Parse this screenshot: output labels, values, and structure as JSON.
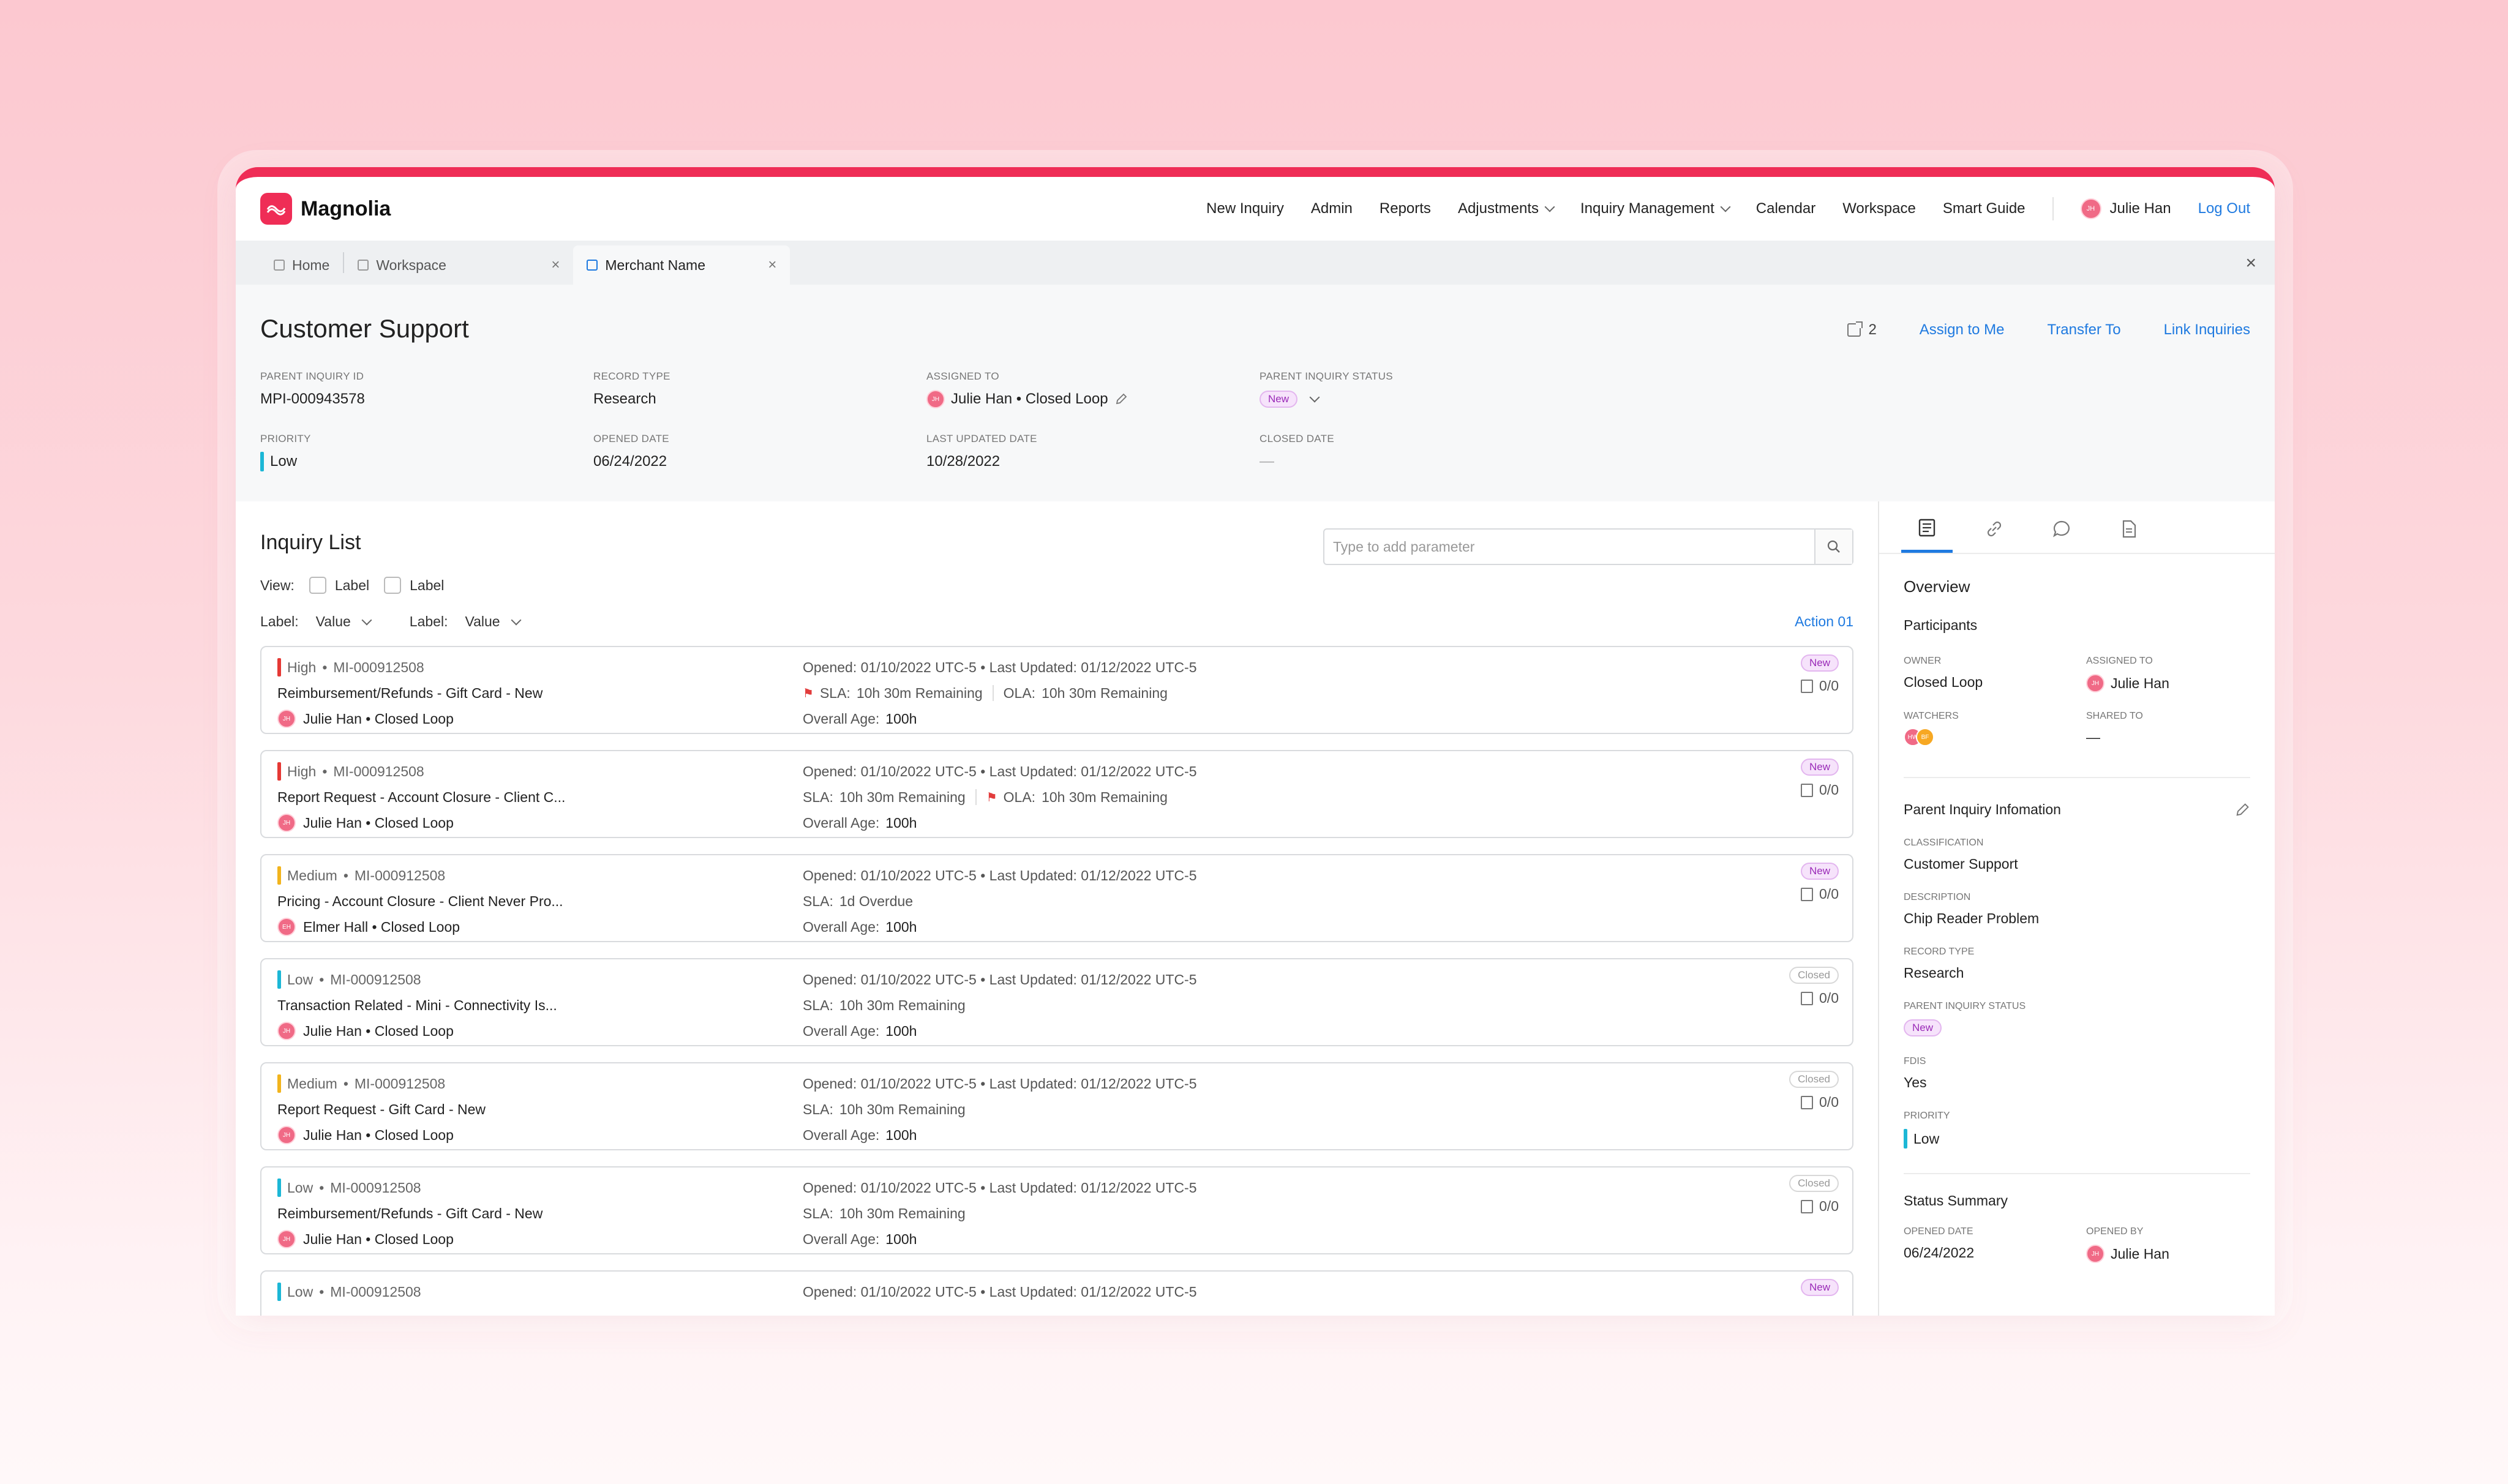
{
  "app": {
    "name": "Magnolia"
  },
  "nav": {
    "items": [
      "New Inquiry",
      "Admin",
      "Reports",
      "Adjustments",
      "Inquiry Management",
      "Calendar",
      "Workspace",
      "Smart Guide"
    ],
    "user_initials": "JH",
    "user_name": "Julie Han",
    "logout": "Log Out"
  },
  "tabs": [
    {
      "label": "Home"
    },
    {
      "label": "Workspace"
    },
    {
      "label": "Merchant Name"
    }
  ],
  "header": {
    "title": "Customer Support",
    "link_count": "2",
    "actions": [
      "Assign to Me",
      "Transfer To",
      "Link Inquiries"
    ],
    "fields": {
      "parent_inquiry_id": {
        "label": "Parent Inquiry ID",
        "value": "MPI-000943578"
      },
      "record_type": {
        "label": "Record Type",
        "value": "Research"
      },
      "assigned_to": {
        "label": "Assigned To",
        "value": "Julie Han • Closed Loop",
        "initials": "JH"
      },
      "status": {
        "label": "Parent Inquiry Status",
        "value": "New"
      },
      "priority": {
        "label": "Priority",
        "value": "Low"
      },
      "opened_date": {
        "label": "Opened Date",
        "value": "06/24/2022"
      },
      "last_updated": {
        "label": "Last Updated Date",
        "value": "10/28/2022"
      },
      "closed_date": {
        "label": "Closed Date",
        "value": "—"
      }
    }
  },
  "inquiry_list": {
    "title": "Inquiry List",
    "search_placeholder": "Type to add parameter",
    "view_label": "View:",
    "checkboxes": [
      "Label",
      "Label"
    ],
    "filters": [
      {
        "label": "Label:",
        "value": "Value"
      },
      {
        "label": "Label:",
        "value": "Value"
      }
    ],
    "action": "Action 01",
    "cards": [
      {
        "priority": "High",
        "id": "MI-000912508",
        "title": "Reimbursement/Refunds - Gift Card - New",
        "owner": "Julie Han • Closed Loop",
        "initials": "JH",
        "opened": "Opened:  01/10/2022 UTC-5 • Last Updated: 01/12/2022 UTC-5",
        "sla": "SLA: ",
        "sla_val": "10h 30m Remaining",
        "ola": "OLA: ",
        "ola_val": "10h 30m Remaining",
        "age_label": "Overall Age: ",
        "age": "100h",
        "status": "New",
        "count": "0/0"
      },
      {
        "priority": "High",
        "id": "MI-000912508",
        "title": "Report Request - Account Closure - Client C...",
        "owner": "Julie Han • Closed Loop",
        "initials": "JH",
        "opened": "Opened:  01/10/2022 UTC-5 • Last Updated: 01/12/2022 UTC-5",
        "sla": "SLA: ",
        "sla_val": "10h 30m Remaining",
        "ola": "OLA: ",
        "ola_val": "10h 30m Remaining",
        "age_label": "Overall Age: ",
        "age": "100h",
        "status": "New",
        "count": "0/0"
      },
      {
        "priority": "Medium",
        "id": "MI-000912508",
        "title": "Pricing - Account Closure - Client Never Pro...",
        "owner": "Elmer Hall • Closed Loop",
        "initials": "EH",
        "opened": "Opened:  01/10/2022 UTC-5 • Last Updated: 01/12/2022 UTC-5",
        "sla": "SLA: ",
        "sla_val": "1d Overdue",
        "age_label": "Overall Age: ",
        "age": "100h",
        "status": "New",
        "count": "0/0"
      },
      {
        "priority": "Low",
        "id": "MI-000912508",
        "title": "Transaction Related - Mini - Connectivity Is...",
        "owner": "Julie Han • Closed Loop",
        "initials": "JH",
        "opened": "Opened:  01/10/2022 UTC-5 • Last Updated: 01/12/2022 UTC-5",
        "sla": "SLA: ",
        "sla_val": "10h 30m Remaining",
        "age_label": "Overall Age: ",
        "age": "100h",
        "status": "Closed",
        "count": "0/0"
      },
      {
        "priority": "Medium",
        "id": "MI-000912508",
        "title": "Report Request - Gift Card - New",
        "owner": "Julie Han • Closed Loop",
        "initials": "JH",
        "opened": "Opened:  01/10/2022 UTC-5 • Last Updated: 01/12/2022 UTC-5",
        "sla": "SLA: ",
        "sla_val": "10h 30m Remaining",
        "age_label": "Overall Age: ",
        "age": "100h",
        "status": "Closed",
        "count": "0/0"
      },
      {
        "priority": "Low",
        "id": "MI-000912508",
        "title": "Reimbursement/Refunds - Gift Card - New",
        "owner": "Julie Han • Closed Loop",
        "initials": "JH",
        "opened": "Opened:  01/10/2022 UTC-5 • Last Updated: 01/12/2022 UTC-5",
        "sla": "SLA: ",
        "sla_val": "10h 30m Remaining",
        "age_label": "Overall Age: ",
        "age": "100h",
        "status": "Closed",
        "count": "0/0"
      },
      {
        "priority": "Low",
        "id": "MI-000912508",
        "opened": "Opened:  01/10/2022 UTC-5 • Last Updated: 01/12/2022 UTC-5",
        "status": "New"
      }
    ]
  },
  "panel": {
    "overview": "Overview",
    "participants": "Participants",
    "owner": {
      "label": "Owner",
      "value": "Closed Loop"
    },
    "assigned_to": {
      "label": "Assigned To",
      "value": "Julie Han",
      "initials": "JH"
    },
    "watchers": {
      "label": "Watchers",
      "avatars": [
        "HW",
        "BF"
      ]
    },
    "shared_to": {
      "label": "Shared To",
      "value": "—"
    },
    "parent_info": "Parent Inquiry Infomation",
    "classification": {
      "label": "Classification",
      "value": "Customer Support"
    },
    "description": {
      "label": "Description",
      "value": "Chip Reader Problem"
    },
    "record_type": {
      "label": "Record Type",
      "value": "Research"
    },
    "status": {
      "label": "Parent Inquiry Status",
      "value": "New"
    },
    "fdis": {
      "label": "FDIS",
      "value": "Yes"
    },
    "priority": {
      "label": "Priority",
      "value": "Low"
    },
    "status_summary": "Status Summary",
    "opened_date": {
      "label": "Opened Date",
      "value": "06/24/2022"
    },
    "opened_by": {
      "label": "Opened By",
      "value": "Julie Han",
      "initials": "JH"
    }
  },
  "colors": {
    "brand": "#ef2d56",
    "link": "#1f7ae0",
    "high": "#e53935",
    "medium": "#f2b41d",
    "low": "#1cb7d6"
  }
}
